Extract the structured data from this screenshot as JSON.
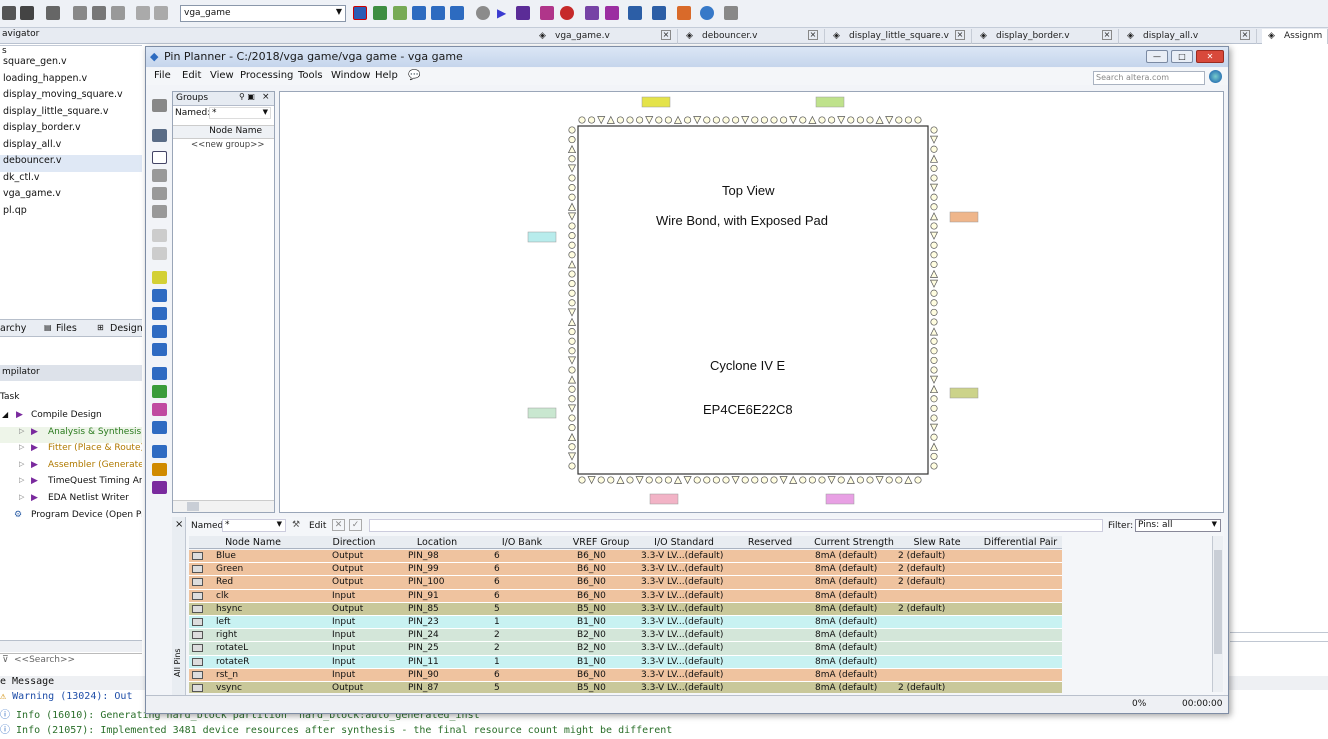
{
  "toolbar": {
    "project_combo": "vga_game"
  },
  "doc_tabs": [
    {
      "label": "vga_game.v"
    },
    {
      "label": "debouncer.v"
    },
    {
      "label": "display_little_square.v"
    },
    {
      "label": "display_border.v"
    },
    {
      "label": "display_all.v"
    },
    {
      "label": "Assignm"
    }
  ],
  "navigator": {
    "title": "avigator",
    "section": "s",
    "files": [
      "square_gen.v",
      "loading_happen.v",
      "display_moving_square.v",
      "display_little_square.v",
      "display_border.v",
      "display_all.v",
      "debouncer.v",
      "dk_ctl.v",
      "vga_game.v",
      "pl.qp"
    ],
    "tabs": [
      "archy",
      "Files",
      "Design"
    ]
  },
  "compilation": {
    "title": "mpilator",
    "task_header": "Task",
    "tasks": [
      {
        "label": "Compile Design",
        "color": "#111111"
      },
      {
        "label": "Analysis & Synthesis",
        "color": "#2a7a1e"
      },
      {
        "label": "Fitter (Place & Route)",
        "color": "#b07a00"
      },
      {
        "label": "Assembler (Generate pr",
        "color": "#b07a00"
      },
      {
        "label": "TimeQuest Timing Analy",
        "color": "#111111"
      },
      {
        "label": "EDA Netlist Writer",
        "color": "#111111"
      },
      {
        "label": "Program Device (Open Prog",
        "color": "#111111"
      }
    ],
    "search_placeholder": "<<Search>>"
  },
  "messages": {
    "header": "e Message",
    "lines": [
      {
        "type": "warning",
        "text": "Warning (13024): Out"
      },
      {
        "type": "info",
        "text": "Info (16010): Generating hard_block partition \"hard_block:auto_generated_inst\""
      },
      {
        "type": "info",
        "text": "Info (21057): Implemented 3481 device resources after synthesis - the final resource count might be different"
      }
    ]
  },
  "pin_planner": {
    "title": "Pin Planner - C:/2018/vga game/vga game - vga game",
    "menu": [
      "File",
      "Edit",
      "View",
      "Processing",
      "Tools",
      "Window",
      "Help"
    ],
    "search_placeholder": "Search altera.com",
    "groups": {
      "title": "Groups",
      "named_label": "Named:",
      "named_value": "*",
      "col": "Node Name",
      "new_group": "<<new group>>"
    },
    "chip": {
      "line1": "Top View",
      "line2": "Wire Bond, with Exposed Pad",
      "family": "Cyclone IV E",
      "device": "EP4CE6E22C8"
    },
    "filter": {
      "named_label": "Named:",
      "named_value": "*",
      "edit": "Edit",
      "filter_label": "Filter:",
      "filter_value": "Pins: all"
    },
    "columns": [
      "Node Name",
      "Direction",
      "Location",
      "I/O Bank",
      "VREF Group",
      "I/O Standard",
      "Reserved",
      "Current Strength",
      "Slew Rate",
      "Differential Pair"
    ],
    "rows": [
      {
        "name": "Blue",
        "dir": "Output",
        "loc": "PIN_98",
        "bank": "6",
        "vref": "B6_N0",
        "std": "3.3-V LV...(default)",
        "cur": "8mA (default)",
        "slew": "2 (default)",
        "bg": "#efc39f"
      },
      {
        "name": "Green",
        "dir": "Output",
        "loc": "PIN_99",
        "bank": "6",
        "vref": "B6_N0",
        "std": "3.3-V LV...(default)",
        "cur": "8mA (default)",
        "slew": "2 (default)",
        "bg": "#efc39f"
      },
      {
        "name": "Red",
        "dir": "Output",
        "loc": "PIN_100",
        "bank": "6",
        "vref": "B6_N0",
        "std": "3.3-V LV...(default)",
        "cur": "8mA (default)",
        "slew": "2 (default)",
        "bg": "#efc39f"
      },
      {
        "name": "clk",
        "dir": "Input",
        "loc": "PIN_91",
        "bank": "6",
        "vref": "B6_N0",
        "std": "3.3-V LV...(default)",
        "cur": "8mA (default)",
        "slew": "",
        "bg": "#efc39f"
      },
      {
        "name": "hsync",
        "dir": "Output",
        "loc": "PIN_85",
        "bank": "5",
        "vref": "B5_N0",
        "std": "3.3-V LV...(default)",
        "cur": "8mA (default)",
        "slew": "2 (default)",
        "bg": "#c9c89a"
      },
      {
        "name": "left",
        "dir": "Input",
        "loc": "PIN_23",
        "bank": "1",
        "vref": "B1_N0",
        "std": "3.3-V LV...(default)",
        "cur": "8mA (default)",
        "slew": "",
        "bg": "#c8f2f2"
      },
      {
        "name": "right",
        "dir": "Input",
        "loc": "PIN_24",
        "bank": "2",
        "vref": "B2_N0",
        "std": "3.3-V LV...(default)",
        "cur": "8mA (default)",
        "slew": "",
        "bg": "#d3e6d9"
      },
      {
        "name": "rotateL",
        "dir": "Input",
        "loc": "PIN_25",
        "bank": "2",
        "vref": "B2_N0",
        "std": "3.3-V LV...(default)",
        "cur": "8mA (default)",
        "slew": "",
        "bg": "#d3e6d9"
      },
      {
        "name": "rotateR",
        "dir": "Input",
        "loc": "PIN_11",
        "bank": "1",
        "vref": "B1_N0",
        "std": "3.3-V LV...(default)",
        "cur": "8mA (default)",
        "slew": "",
        "bg": "#c8f2f2"
      },
      {
        "name": "rst_n",
        "dir": "Input",
        "loc": "PIN_90",
        "bank": "6",
        "vref": "B6_N0",
        "std": "3.3-V LV...(default)",
        "cur": "8mA (default)",
        "slew": "",
        "bg": "#efc39f"
      },
      {
        "name": "vsync",
        "dir": "Output",
        "loc": "PIN_87",
        "bank": "5",
        "vref": "B5_N0",
        "std": "3.3-V LV...(default)",
        "cur": "8mA (default)",
        "slew": "2 (default)",
        "bg": "#c9c89a"
      }
    ],
    "side_label": "All Pins",
    "status": {
      "percent": "0%",
      "time": "00:00:00"
    }
  },
  "colors": {
    "accent": "#3b6fb6",
    "window_title": "#c5d5ec"
  }
}
